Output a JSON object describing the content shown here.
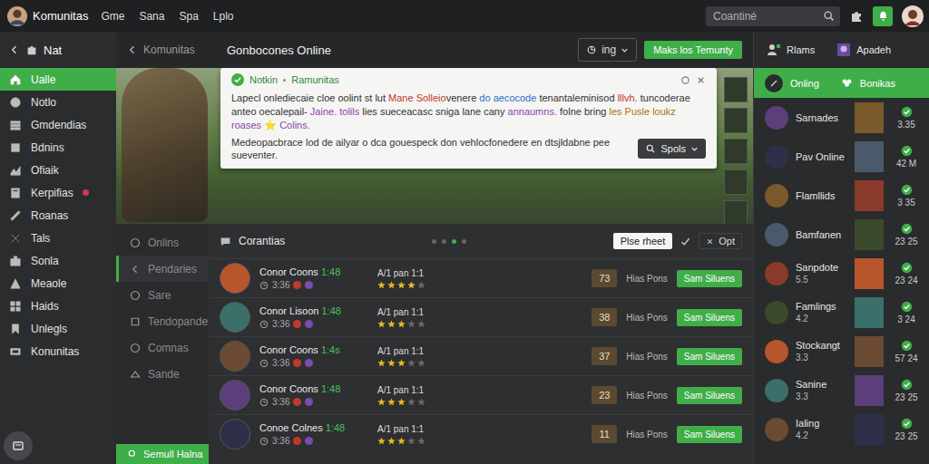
{
  "topbar": {
    "brand": "Komunitas",
    "nav": [
      "Gme",
      "Sana",
      "Spa",
      "Lplo"
    ],
    "search": {
      "placeholder": "Coantiné"
    }
  },
  "sidebar": {
    "header": "Nat",
    "items": [
      {
        "label": "Ualle",
        "selected": true,
        "badge": false
      },
      {
        "label": "Notlo",
        "selected": false,
        "badge": false
      },
      {
        "label": "Gmdendias",
        "selected": false,
        "badge": false
      },
      {
        "label": "Bdnins",
        "selected": false,
        "badge": false
      },
      {
        "label": "Ofiaik",
        "selected": false,
        "badge": false
      },
      {
        "label": "Kerpifias",
        "selected": false,
        "badge": true
      },
      {
        "label": "Roanas",
        "selected": false,
        "badge": false
      },
      {
        "label": "Tals",
        "selected": false,
        "badge": false
      },
      {
        "label": "Sonla",
        "selected": false,
        "badge": false
      },
      {
        "label": "Meaole",
        "selected": false,
        "badge": false
      },
      {
        "label": "Haids",
        "selected": false,
        "badge": false
      },
      {
        "label": "Unlegls",
        "selected": false,
        "badge": false
      },
      {
        "label": "Konunitas",
        "selected": false,
        "badge": false
      }
    ]
  },
  "main_header": {
    "back_label": "Komunitas",
    "title": "Gonbocones Online",
    "filter": "ing",
    "primary": "Maks los Temunty"
  },
  "notification": {
    "title": "Notkin",
    "source": "Ramunitas",
    "paragraph": [
      {
        "text": "Lapecl onlediecaie cloe oolint st lut ",
        "color": "#333333"
      },
      {
        "text": "Mane Solleio",
        "color": "#c0392b"
      },
      {
        "text": "venere ",
        "color": "#333333"
      },
      {
        "text": "do aecocode",
        "color": "#2a6fc9"
      },
      {
        "text": " tenantaleminisod ",
        "color": "#333333"
      },
      {
        "text": "lllvh.",
        "color": "#c0392b"
      },
      {
        "text": " tuncoderae anteo oecalepail- ",
        "color": "#333333"
      },
      {
        "text": "Jaine. tolils",
        "color": "#8e44ad"
      },
      {
        "text": " lies sueceacasc sniga lane cany ",
        "color": "#333333"
      },
      {
        "text": "annaumns.",
        "color": "#8e44ad"
      },
      {
        "text": " folne bring ",
        "color": "#333333"
      },
      {
        "text": "les Pusle loukz",
        "color": "#a87800"
      },
      {
        "text": " roases ",
        "color": "#8e44ad"
      },
      {
        "text": "⭐",
        "color": "#a87800"
      },
      {
        "text": " Colins.",
        "color": "#8e44ad"
      }
    ],
    "footer": "Medeopacbrace lod de ailyar o dca gouespeck don vehlocfonedere en dtsjldabne pee sueventer.",
    "button": "Spols"
  },
  "subnav": {
    "items": [
      {
        "label": "Onlins",
        "selected": false
      },
      {
        "label": "Pendaries",
        "selected": true
      },
      {
        "label": "Sare",
        "selected": false
      },
      {
        "label": "Tendopande",
        "selected": false
      },
      {
        "label": "Comnas",
        "selected": false
      },
      {
        "label": "Sande",
        "selected": false
      }
    ],
    "bottom": "Semull Halna"
  },
  "feed": {
    "title": "Corantias",
    "pages": [
      {
        "selected": false
      },
      {
        "selected": false
      },
      {
        "selected": true
      },
      {
        "selected": false
      }
    ],
    "button": "Plse rheet",
    "option": "Opt",
    "rows": [
      {
        "name": "Conor Coons",
        "time": "1:48",
        "meta": "3:36",
        "info": "A/1 pan 1:1",
        "stars": 4,
        "count": "73",
        "label": "Hias Pons",
        "action": "Sam Siluens"
      },
      {
        "name": "Conor Lisoon",
        "time": "1:48",
        "meta": "3:36",
        "info": "A/1 pan 1:1",
        "stars": 3,
        "count": "38",
        "label": "Hias Pons",
        "action": "Sam Siluens"
      },
      {
        "name": "Conor Coons",
        "time": "1:4s",
        "meta": "3:36",
        "info": "A/1 pan 1:1",
        "stars": 3,
        "count": "37",
        "label": "Hias Pons",
        "action": "Sam Siluens"
      },
      {
        "name": "Conor Coons",
        "time": "1:48",
        "meta": "3:36",
        "info": "A/1 pan 1:1",
        "stars": 3,
        "count": "23",
        "label": "Hias Pons",
        "action": "Sam Siluens"
      },
      {
        "name": "Conoe Colnes",
        "time": "1:48",
        "meta": "3:36",
        "info": "A/1 pan 1:1",
        "stars": 3,
        "count": "11",
        "label": "Hias Pons",
        "action": "Sam Siluens"
      }
    ]
  },
  "right_panel": {
    "header": [
      "Rlams",
      "Apadeh"
    ],
    "bar": [
      "Onling",
      "Bonikas"
    ],
    "rows": [
      {
        "name": "Sarnades",
        "value": "3.35"
      },
      {
        "name": "Pav Online",
        "value": "42 M"
      },
      {
        "name": "Flamllids",
        "value": "3 35"
      },
      {
        "name": "Bamfanen",
        "value": "23 25"
      },
      {
        "name": "Sanpdote",
        "sub": "5.5",
        "value": "23 24"
      },
      {
        "name": "Famlings",
        "sub": "4.2",
        "value": "3 24"
      },
      {
        "name": "Stockangt",
        "sub": "3.3",
        "value": "57 24"
      },
      {
        "name": "Sanine",
        "sub": "3.3",
        "value": "23 25"
      },
      {
        "name": "Ialing",
        "sub": "4.2",
        "value": "23 25"
      }
    ]
  }
}
